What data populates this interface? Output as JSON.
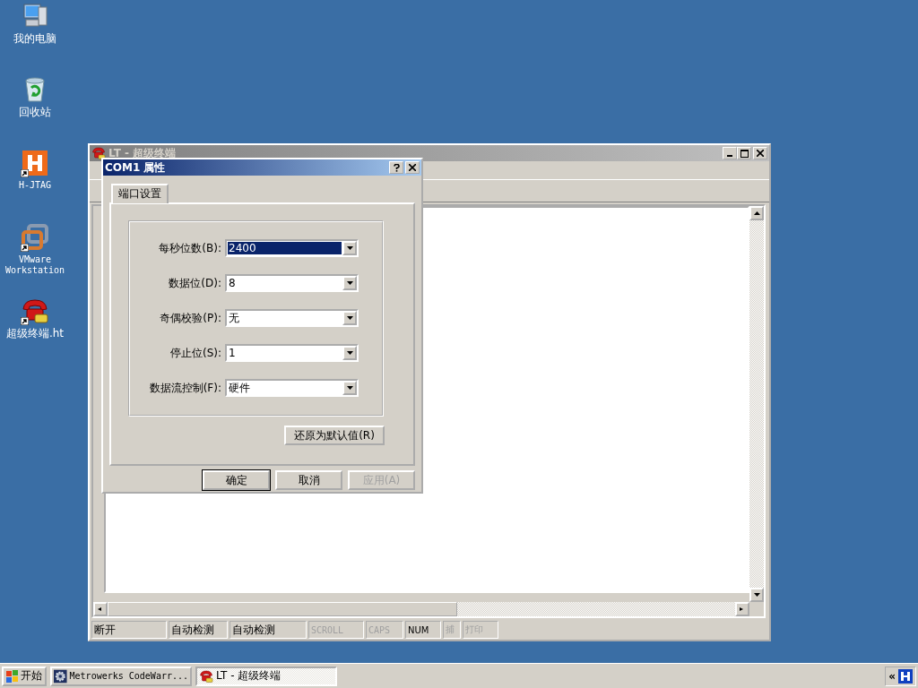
{
  "desktop_icons": [
    {
      "label": "我的电脑",
      "kind": "computer",
      "shortcut": false
    },
    {
      "label": "回收站",
      "kind": "recycle",
      "shortcut": false
    },
    {
      "label": "H-JTAG",
      "kind": "hjtag",
      "shortcut": true
    },
    {
      "label": "VMware Workstation",
      "kind": "vmware",
      "shortcut": true
    },
    {
      "label": "超级终端.ht",
      "kind": "phone",
      "shortcut": true
    }
  ],
  "main_window": {
    "title": "LT - 超级终端",
    "active": false,
    "status_bar": [
      {
        "text": "断开",
        "disabled": false
      },
      {
        "text": "自动检测",
        "disabled": false
      },
      {
        "text": "自动检测",
        "disabled": false
      },
      {
        "text": "SCROLL",
        "disabled": true
      },
      {
        "text": "CAPS",
        "disabled": true
      },
      {
        "text": "NUM",
        "disabled": false
      },
      {
        "text": "捕",
        "disabled": true
      },
      {
        "text": "打印",
        "disabled": true
      }
    ]
  },
  "dialog": {
    "title": "COM1 属性",
    "active": true,
    "tabs": [
      {
        "label": "端口设置",
        "selected": true
      }
    ],
    "fields": [
      {
        "label": "每秒位数(B):",
        "value": "2400",
        "focused": true
      },
      {
        "label": "数据位(D):",
        "value": "8",
        "focused": false
      },
      {
        "label": "奇偶校验(P):",
        "value": "无",
        "focused": false
      },
      {
        "label": "停止位(S):",
        "value": "1",
        "focused": false
      },
      {
        "label": "数据流控制(F):",
        "value": "硬件",
        "focused": false
      }
    ],
    "restore_button": "还原为默认值(R)",
    "buttons": [
      {
        "label": "确定",
        "default": true,
        "disabled": false
      },
      {
        "label": "取消",
        "default": false,
        "disabled": false
      },
      {
        "label": "应用(A)",
        "default": false,
        "disabled": true
      }
    ]
  },
  "taskbar": {
    "start": "开始",
    "tasks": [
      {
        "label": "Metrowerks CodeWarr...",
        "selected": false,
        "kind": "ide"
      },
      {
        "label": "LT - 超级终端",
        "selected": true,
        "kind": "phone"
      }
    ],
    "tray": {
      "chevron": "«"
    }
  }
}
